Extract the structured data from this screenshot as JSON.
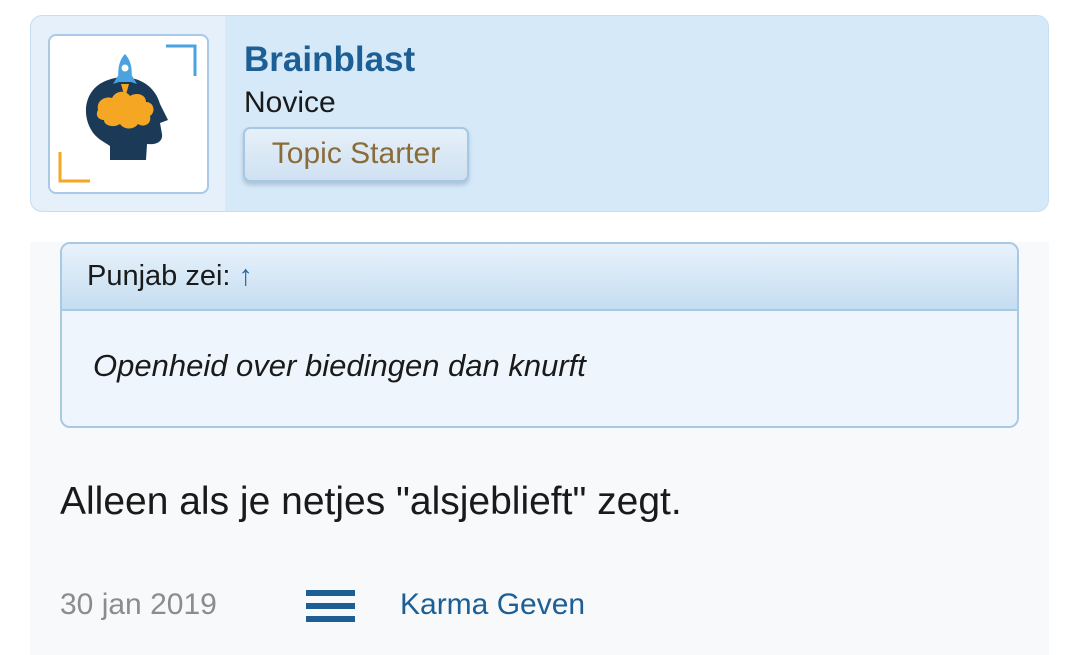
{
  "user": {
    "name": "Brainblast",
    "rank": "Novice",
    "badge": "Topic Starter",
    "avatar_icon": "brain-rocket-icon"
  },
  "quote": {
    "header": "Punjab zei:",
    "arrow": "↑",
    "text": "Openheid over biedingen dan knurft"
  },
  "post": {
    "message": "Alleen als je netjes \"alsjeblieft\" zegt.",
    "date": "30 jan 2019",
    "karma_label": "Karma Geven"
  },
  "colors": {
    "accent": "#1d5f94",
    "card_bg": "#d6e9f9",
    "badge_text": "#8a6c3a",
    "avatar_orange": "#f5a623"
  }
}
